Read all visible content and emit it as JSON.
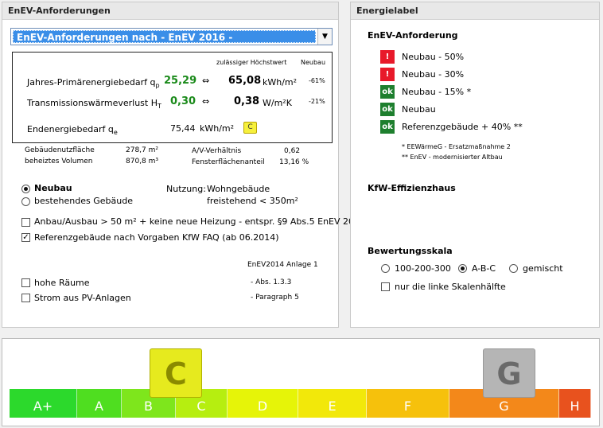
{
  "left_panel": {
    "title": "EnEV-Anforderungen",
    "dropdown_value": "EnEV-Anforderungen nach  - EnEV 2016 -",
    "calc": {
      "header_max": "zulässiger Höchstwert",
      "header_neubau": "Neubau",
      "rows": [
        {
          "label": "Jahres-Primärenergiebedarf q",
          "sub": "p",
          "value": "25,29",
          "arrow": "⇔",
          "limit": "65,08",
          "unit": "kWh/m²",
          "pct": "-61%"
        },
        {
          "label": "Transmissionswärmeverlust H",
          "sub": "T",
          "value": "0,30",
          "arrow": "⇔",
          "limit": "0,38",
          "unit": "W/m²K",
          "pct": "-21%"
        }
      ],
      "end_label": "Endenergiebedarf q",
      "end_sub": "e",
      "end_value": "75,44",
      "end_unit": "kWh/m²",
      "end_class": "C"
    },
    "info": {
      "nutz_label": "Gebäudenutzfläche",
      "nutz_value": "278,7 m²",
      "vol_label": "beheiztes Volumen",
      "vol_value": "870,8 m³",
      "av_label": "A/V-Verhältnis",
      "av_value": "0,62",
      "fenster_label": "Fensterflächenanteil",
      "fenster_value": "13,16 %"
    },
    "neubau_label": "Neubau",
    "bestand_label": "bestehendes Gebäude",
    "nutzung_label": "Nutzung:",
    "nutzung_value1": "Wohngebäude",
    "nutzung_value2": "freistehend < 350m²",
    "anbau_label": "Anbau/Ausbau > 50 m² + keine neue Heizung  - entspr. §9 Abs.5 EnEV 2009",
    "referenz_label": "Referenzgebäude nach Vorgaben KfW FAQ (ab 06.2014)",
    "anlage_label": "EnEV2014  Anlage 1",
    "hohe_label": "hohe Räume",
    "hohe_ref": "-  Abs. 1.3.3",
    "pv_label": "Strom aus PV-Anlagen",
    "pv_ref": "-  Paragraph 5"
  },
  "right_panel": {
    "title": "Energielabel",
    "enev_heading": "EnEV-Anforderung",
    "requirements": [
      {
        "status": "!",
        "color": "red",
        "label": "Neubau - 50%"
      },
      {
        "status": "!",
        "color": "red",
        "label": "Neubau - 30%"
      },
      {
        "status": "ok",
        "color": "green",
        "label": "Neubau - 15% *"
      },
      {
        "status": "ok",
        "color": "green",
        "label": "Neubau"
      },
      {
        "status": "ok",
        "color": "green",
        "label": "Referenzgebäude + 40% **"
      }
    ],
    "footnote1": "*   EEWärmeG - Ersatzmaßnahme 2",
    "footnote2": "**  EnEV - modernisierter Altbau",
    "kfw_heading": "KfW-Effizienzhaus",
    "scale_heading": "Bewertungsskala",
    "scale_opt1": "100-200-300",
    "scale_opt2": "A-B-C",
    "scale_opt3": "gemischt",
    "half_label": "nur die linke Skalenhälfte"
  },
  "scale": {
    "segments": [
      "A+",
      "A",
      "B",
      "C",
      "D",
      "E",
      "F",
      "G",
      "H"
    ],
    "marker_current": "C",
    "marker_reference": "G",
    "colors": {
      "marker_current": "#e6ea1e",
      "marker_reference": "#b5b5b5"
    }
  }
}
